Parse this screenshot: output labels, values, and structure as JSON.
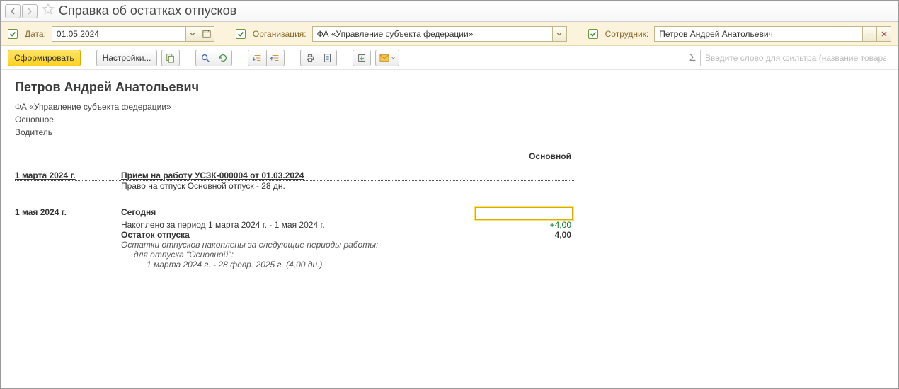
{
  "title": "Справка об остатках отпусков",
  "filters": {
    "date_label": "Дата:",
    "date_value": "01.05.2024",
    "org_label": "Организация:",
    "org_value": "ФА «Управление субъекта федерации»",
    "emp_label": "Сотрудник:",
    "emp_value": "Петров Андрей Анатольевич"
  },
  "toolbar": {
    "form_label": "Сформировать",
    "settings_label": "Настройки...",
    "filter_placeholder": "Введите слово для фильтра (название товара, п"
  },
  "report": {
    "person": "Петров Андрей Анатольевич",
    "org": "ФА «Управление субъекта федерации»",
    "contract": "Основное",
    "position": "Водитель",
    "col_header": "Основной",
    "hire": {
      "date": "1 марта 2024 г.",
      "doc": "Прием на работу УСЗК-000004 от 01.03.2024",
      "right": "Право на отпуск Основной отпуск - 28 дн."
    },
    "today": {
      "date": "1 мая 2024 г.",
      "label": "Сегодня",
      "accum": "Накоплено за период 1 марта 2024 г. - 1 мая 2024 г.",
      "accum_val": "+4,00",
      "balance_label": "Остаток отпуска",
      "balance_val": "4,00",
      "note1": "Остатки отпусков накоплены за следующие периоды работы:",
      "note2": "для отпуска \"Основной\":",
      "note3": "1 марта 2024 г. - 28 февр. 2025 г. (4,00 дн.)"
    }
  }
}
